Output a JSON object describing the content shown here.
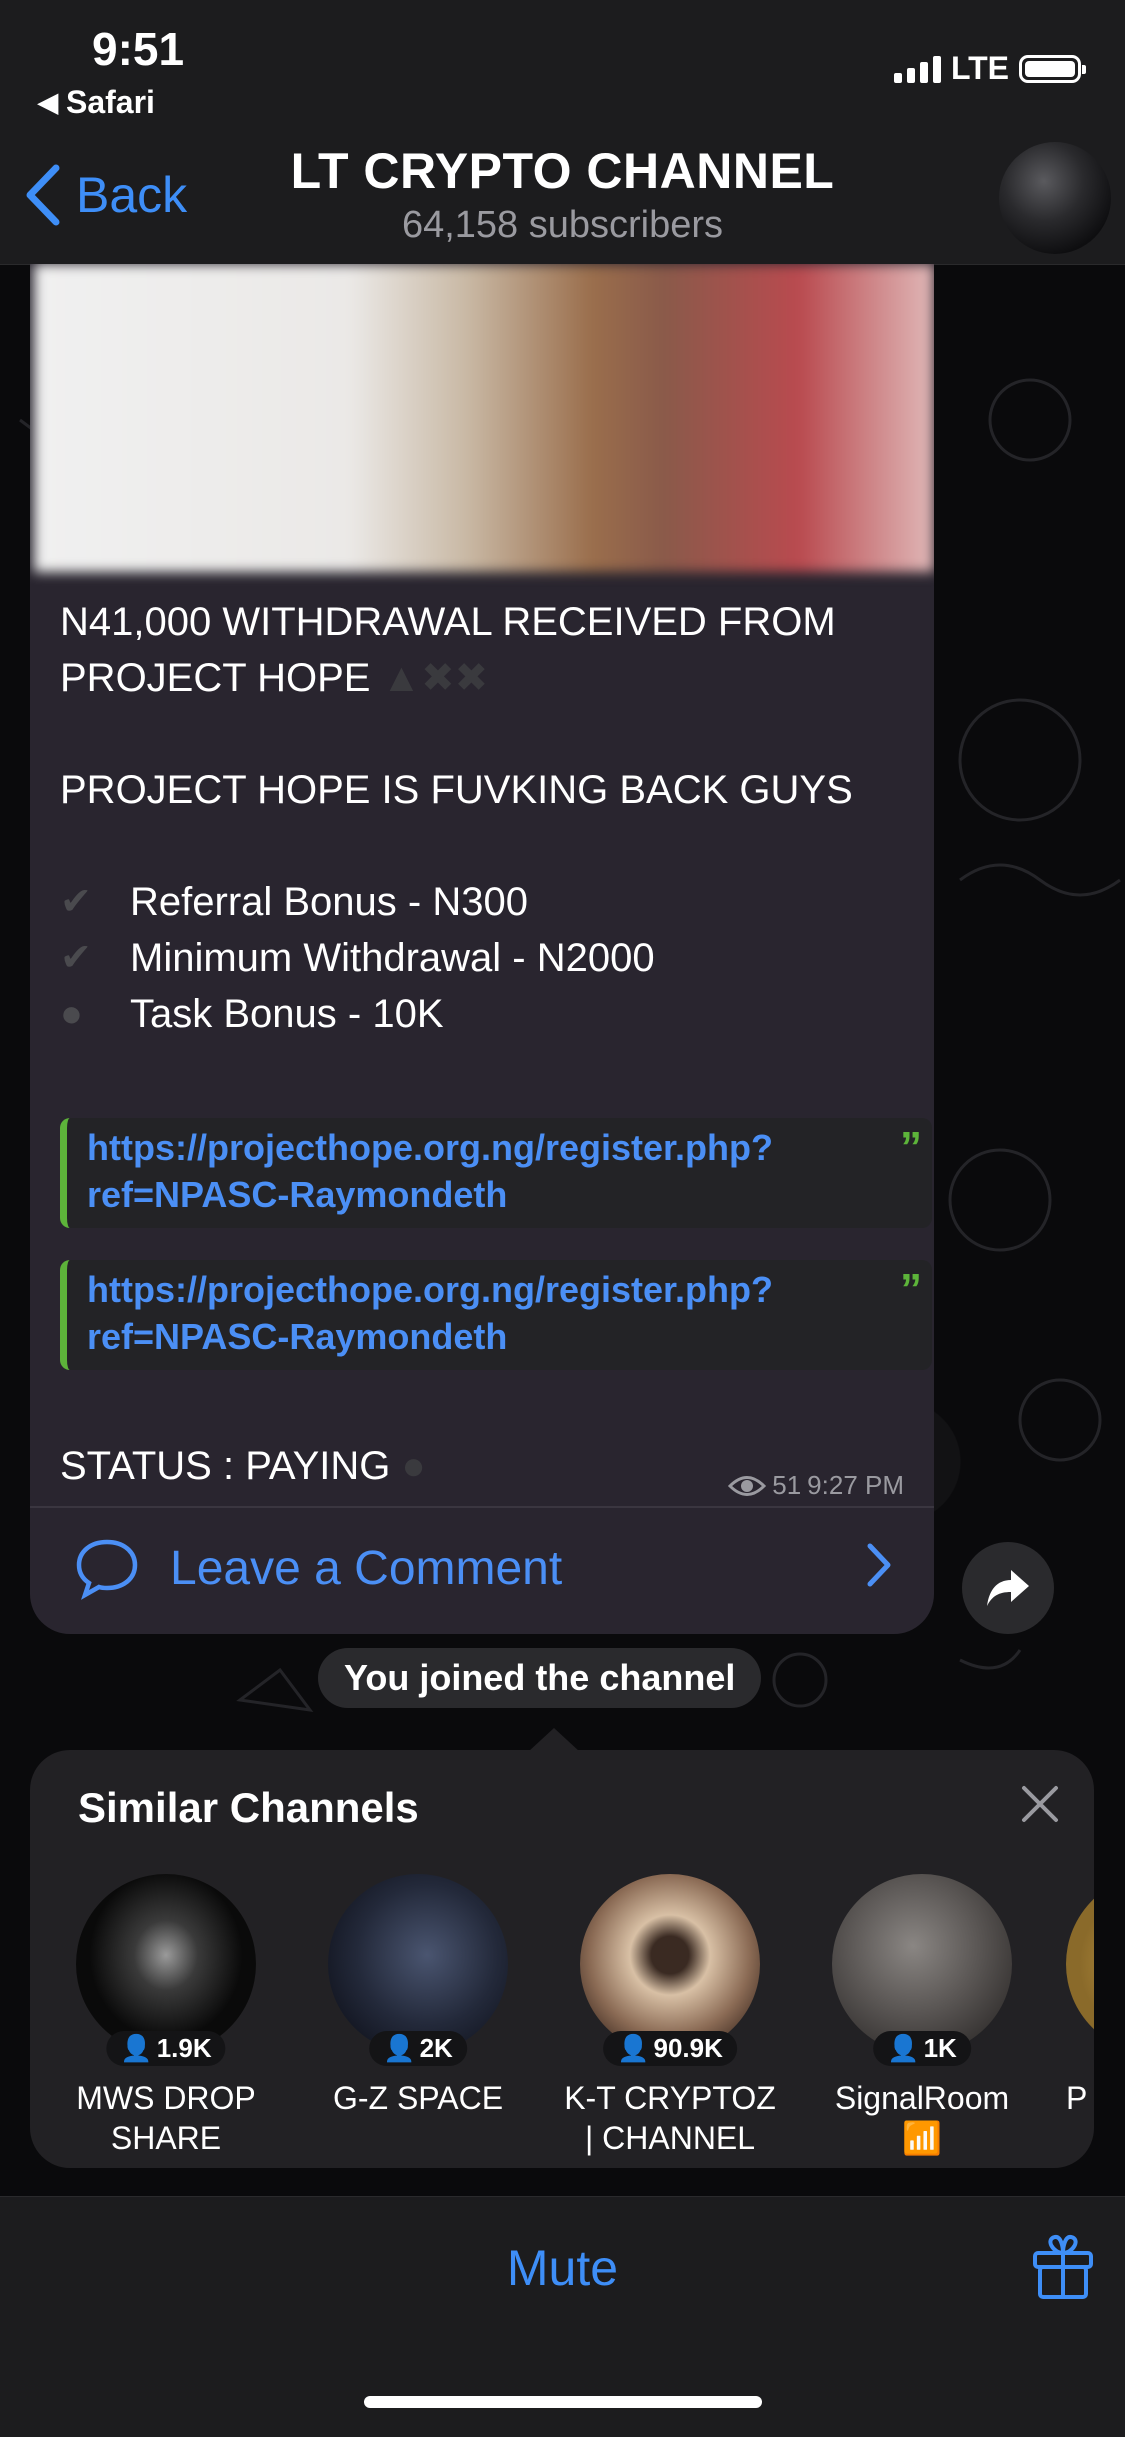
{
  "status_bar": {
    "time": "9:51",
    "back_app": "Safari",
    "network": "LTE"
  },
  "header": {
    "back_label": "Back",
    "title": "LT CRYPTO CHANNEL",
    "subtitle": "64,158 subscribers"
  },
  "message": {
    "line1": "N41,000 WITHDRAWAL RECEIVED FROM",
    "line2": "PROJECT HOPE",
    "line3": "PROJECT HOPE IS FUVKING BACK GUYS",
    "items": [
      {
        "text": "Referral Bonus - N300",
        "icon": "check-icon"
      },
      {
        "text": "Minimum Withdrawal - N2000",
        "icon": "check-icon"
      },
      {
        "text": "Task Bonus - 10K",
        "icon": "speech-bubble-icon"
      }
    ],
    "links": [
      {
        "line1": "https://projecthope.org.ng/register.php?",
        "line2": "ref=NPASC-Raymondeth"
      },
      {
        "line1": "https://projecthope.org.ng/register.php?",
        "line2": "ref=NPASC-Raymondeth"
      }
    ],
    "status": "STATUS : PAYING",
    "views": "51",
    "time": "9:27 PM",
    "comment_label": "Leave a Comment"
  },
  "joined_text": "You joined the channel",
  "similar": {
    "title": "Similar Channels",
    "channels": [
      {
        "name_line1": "MWS DROP",
        "name_line2": "SHARE",
        "count": "1.9K",
        "color": "#1b1b1b"
      },
      {
        "name_line1": "G-Z SPACE",
        "name_line2": "",
        "count": "2K",
        "color": "#2b3347"
      },
      {
        "name_line1": "K-T CRYPTOZ",
        "name_line2": "| CHANNEL",
        "count": "90.9K",
        "color": "#8a6a54"
      },
      {
        "name_line1": "SignalRoom",
        "name_line2": "📶",
        "count": "1K",
        "color": "#5a5654"
      },
      {
        "name_line1": "P",
        "name_line2": "",
        "count": "",
        "color": "#8a6a2a"
      }
    ]
  },
  "bottom_bar": {
    "mute_label": "Mute"
  }
}
